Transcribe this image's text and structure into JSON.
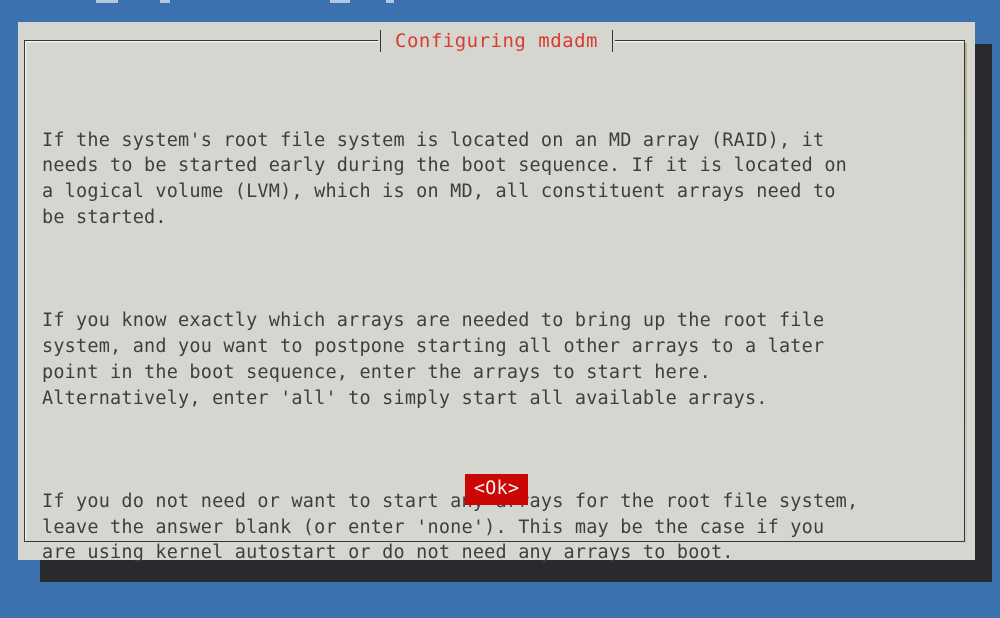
{
  "desktop": {
    "background_color": "#3a71ae"
  },
  "dialog": {
    "title": "Configuring mdadm",
    "title_color": "#d93b30",
    "background_color": "#d4d6cf",
    "text_color": "#3c3f42",
    "shadow_color": "#282a2d",
    "paragraphs": [
      "If the system's root file system is located on an MD array (RAID), it\nneeds to be started early during the boot sequence. If it is located on\na logical volume (LVM), which is on MD, all constituent arrays need to\nbe started.",
      "If you know exactly which arrays are needed to bring up the root file\nsystem, and you want to postpone starting all other arrays to a later\npoint in the boot sequence, enter the arrays to start here.\nAlternatively, enter 'all' to simply start all available arrays.",
      "If you do not need or want to start any arrays for the root file system,\nleave the answer blank (or enter 'none'). This may be the case if you\nare using kernel autostart or do not need any arrays to boot."
    ],
    "buttons": [
      {
        "label": "<Ok>",
        "background_color": "#cc0505",
        "text_color": "#f4f2f0",
        "focused": true
      }
    ]
  }
}
